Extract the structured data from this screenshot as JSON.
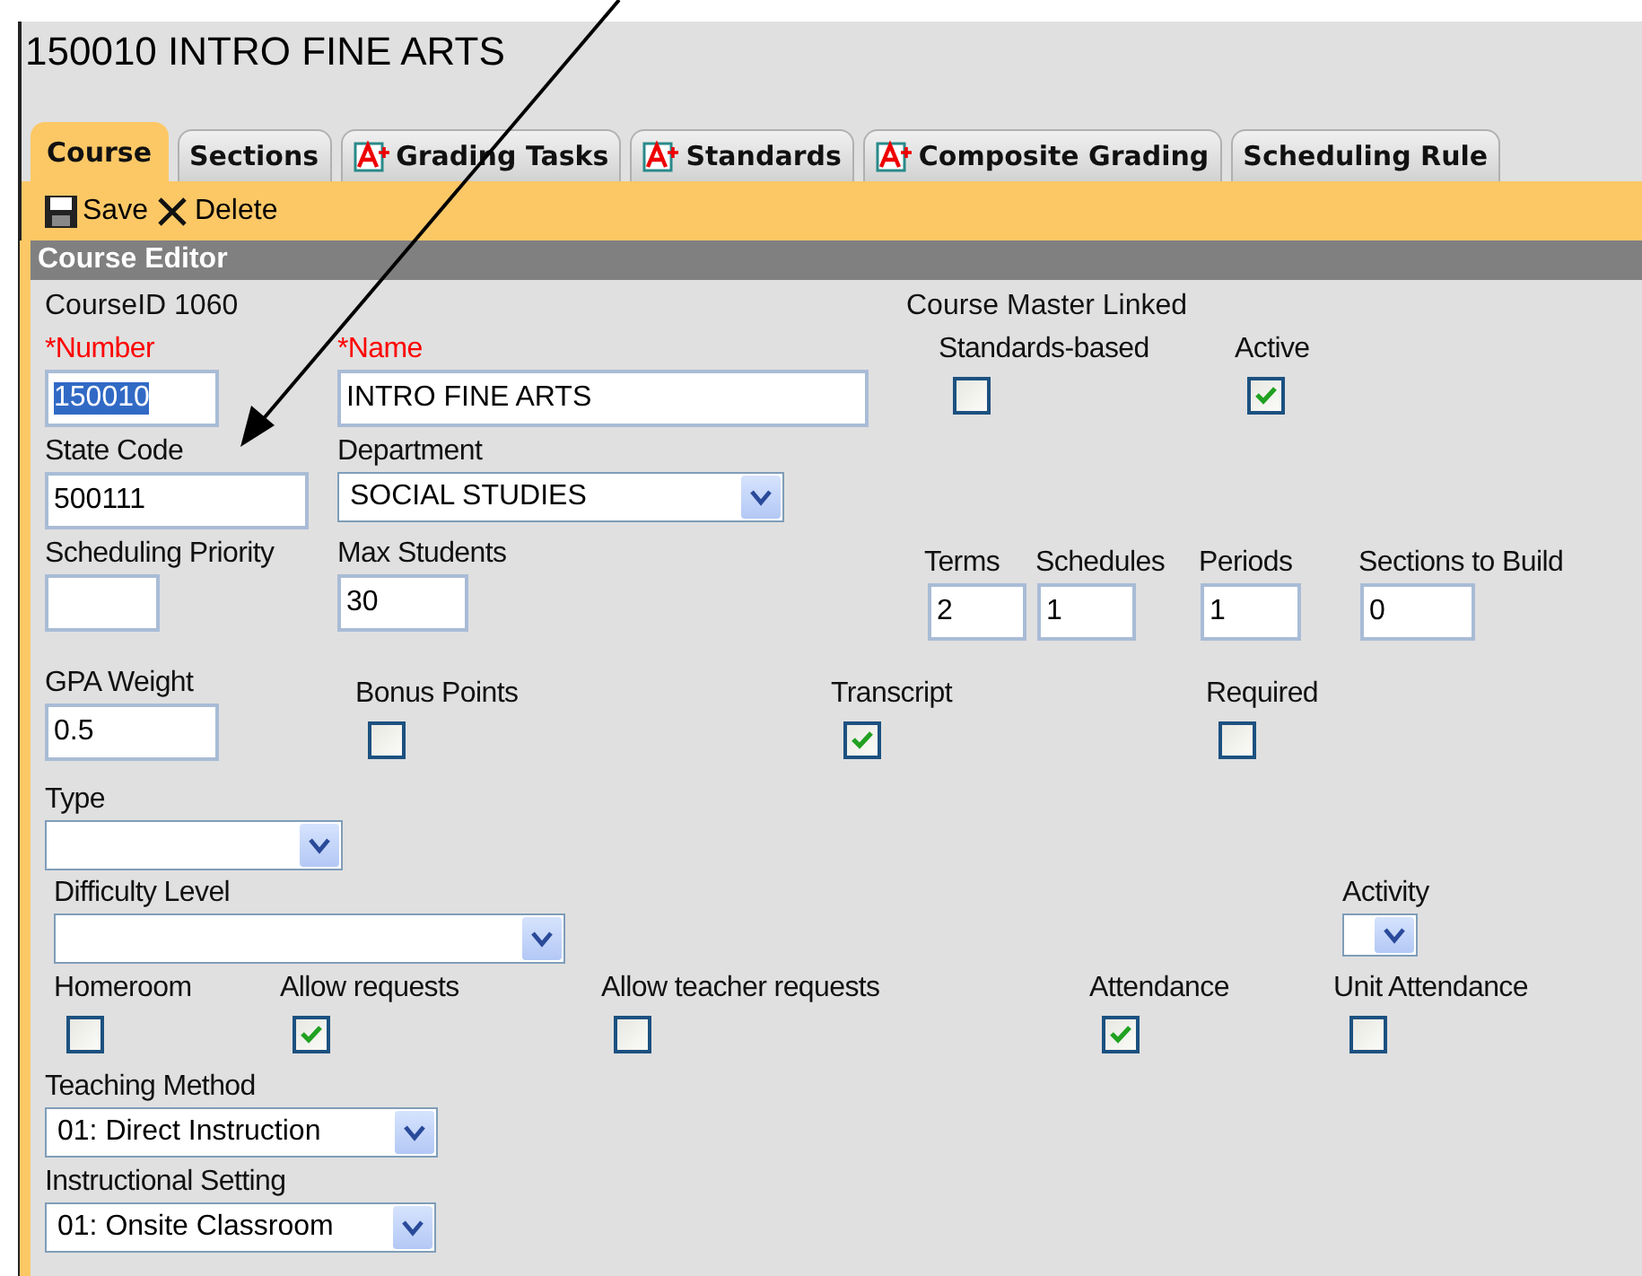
{
  "title": "150010 INTRO FINE ARTS",
  "tabs": [
    {
      "label": "Course",
      "selected": true,
      "kind": "plain"
    },
    {
      "label": "Sections",
      "selected": false,
      "kind": "plain"
    },
    {
      "label": "Grading Tasks",
      "selected": false,
      "kind": "graded"
    },
    {
      "label": "Standards",
      "selected": false,
      "kind": "graded"
    },
    {
      "label": "Composite Grading",
      "selected": false,
      "kind": "graded"
    },
    {
      "label": "Scheduling Rule",
      "selected": false,
      "kind": "plain"
    }
  ],
  "toolbar": [
    {
      "label": "Save",
      "kind": "save"
    },
    {
      "label": "Delete",
      "kind": "delete"
    }
  ],
  "panel_title": "Course Editor",
  "course_id": "CourseID 1060",
  "course_master": "Course Master Linked",
  "number": {
    "label": "*Number",
    "required": true,
    "value": "150010",
    "text_selected": true
  },
  "name": {
    "label": "*Name",
    "required": true,
    "value": "INTRO FINE ARTS"
  },
  "standards_based": {
    "label": "Standards-based",
    "checked": false
  },
  "active": {
    "label": "Active",
    "checked": true
  },
  "state_code": {
    "label": "State Code",
    "value": "500111"
  },
  "department": {
    "label": "Department",
    "value": "SOCIAL STUDIES"
  },
  "scheduling_priority": {
    "label": "Scheduling Priority"
  },
  "max_students": {
    "label": "Max Students",
    "value": "30"
  },
  "terms": {
    "label": "Terms",
    "value": "2"
  },
  "schedules": {
    "label": "Schedules",
    "value": "1"
  },
  "periods": {
    "label": "Periods",
    "value": "1"
  },
  "sections_to_build": {
    "label": "Sections to Build",
    "value": "0"
  },
  "gpa_weight": {
    "label": "GPA Weight",
    "value": "0.5"
  },
  "bonus_points": {
    "label": "Bonus Points",
    "checked": false
  },
  "transcript": {
    "label": "Transcript",
    "checked": true
  },
  "required": {
    "label": "Required",
    "checked": false
  },
  "type": {
    "label": "Type"
  },
  "difficulty_level": {
    "label": "Difficulty Level"
  },
  "activity": {
    "label": "Activity"
  },
  "homeroom": {
    "label": "Homeroom",
    "checked": false
  },
  "allow_requests": {
    "label": "Allow requests",
    "checked": true
  },
  "allow_teacher_requests": {
    "label": "Allow teacher requests",
    "checked": false
  },
  "attendance": {
    "label": "Attendance",
    "checked": true
  },
  "unit_attendance": {
    "label": "Unit Attendance",
    "checked": false
  },
  "teaching_method": {
    "label": "Teaching Method",
    "value": "01: Direct Instruction"
  },
  "instructional_setting": {
    "label": "Instructional Setting",
    "value": "01: Onsite Classroom"
  }
}
